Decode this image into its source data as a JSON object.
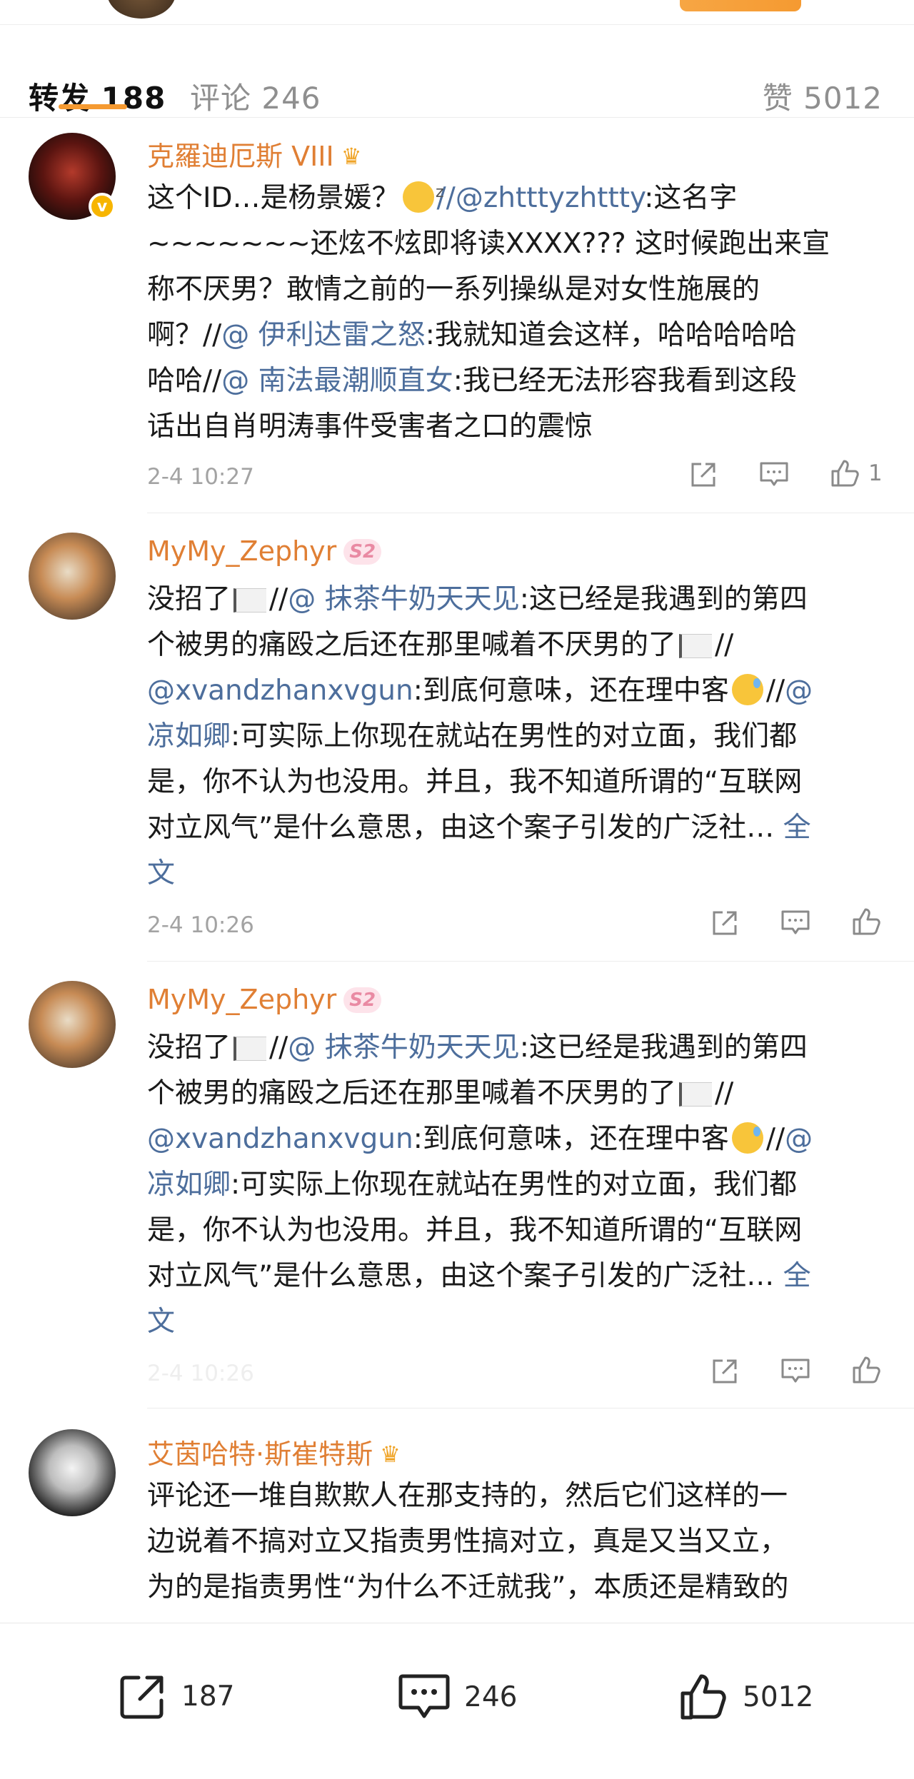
{
  "tabs": {
    "forward": "转发 188",
    "comment": "评论 246",
    "like": "赞 5012"
  },
  "posts": [
    {
      "name": "克羅迪厄斯 VIII",
      "lines": [
        [
          "这个ID…是杨景媛？",
          {
            "emoji": "smug"
          },
          {
            "link": "//@zhtttyzhttty"
          },
          ":这名字"
        ],
        [
          "~~~~~~~还炫不炫即将读XXXX???  这时候跑出来宣"
        ],
        [
          "称不厌男？敢情之前的一系列操纵是对女性施展的"
        ],
        [
          "啊？//",
          {
            "link": "@ 伊利达雷之怒"
          },
          ":我就知道会这样，哈哈哈哈哈"
        ],
        [
          "哈哈//",
          {
            "link": "@ 南法最潮顺直女"
          },
          ":我已经无法形容我看到这段"
        ],
        [
          "话出自肖明涛事件受害者之口的震惊"
        ]
      ],
      "time": "2-4 10:27",
      "likes": "1"
    },
    {
      "name": "MyMy_Zephyr",
      "level": "S2",
      "lines": [
        [
          "没招了",
          {
            "flag": true
          },
          "//",
          {
            "link": "@ 抹茶牛奶天天见"
          },
          ":这已经是我遇到的第四"
        ],
        [
          "个被男的痛殴之后还在那里喊着不厌男的了",
          {
            "flag": true
          },
          "//"
        ],
        [
          {
            "link": "@xvandzhanxvgun"
          },
          ":到底何意味，还在理中客",
          {
            "emoji": "sweat"
          },
          "//",
          {
            "link": "@"
          }
        ],
        [
          {
            "link": "凉如卿"
          },
          ":可实际上你现在就站在男性的对立面，我们都"
        ],
        [
          "是，你不认为也没用。并且，我不知道所谓的“互联网"
        ],
        [
          "对立风气”是什么意思，由这个案子引发的广泛社… ",
          {
            "link": "全"
          }
        ],
        [
          {
            "link": "文"
          }
        ]
      ],
      "time": "2-4 10:26",
      "likes": ""
    },
    {
      "name": "MyMy_Zephyr",
      "level": "S2",
      "lines": [
        [
          "没招了",
          {
            "flag": true
          },
          "//",
          {
            "link": "@ 抹茶牛奶天天见"
          },
          ":这已经是我遇到的第四"
        ],
        [
          "个被男的痛殴之后还在那里喊着不厌男的了",
          {
            "flag": true
          },
          "//"
        ],
        [
          {
            "link": "@xvandzhanxvgun"
          },
          ":到底何意味，还在理中客",
          {
            "emoji": "sweat"
          },
          "//",
          {
            "link": "@"
          }
        ],
        [
          {
            "link": "凉如卿"
          },
          ":可实际上你现在就站在男性的对立面，我们都"
        ],
        [
          "是，你不认为也没用。并且，我不知道所谓的“互联网"
        ],
        [
          "对立风气”是什么意思，由这个案子引发的广泛社… ",
          {
            "link": "全"
          }
        ],
        [
          {
            "link": "文"
          }
        ]
      ],
      "time": "2-4 10:26",
      "likes": ""
    },
    {
      "name": "艾茵哈特·斯崔特斯",
      "lines": [
        [
          "评论还一堆自欺欺人在那支持的，然后它们这样的一"
        ],
        [
          "边说着不搞对立又指责男性搞对立，真是又当又立，"
        ],
        [
          "为的是指责男性“为什么不迁就我”，本质还是精致的"
        ]
      ]
    }
  ],
  "bottom_bar": {
    "forward_count": "187",
    "comment_count": "246",
    "like_count": "5012"
  },
  "colors": {
    "accent": "#f59a31",
    "username": "#e07f34",
    "link": "#4d6e9c",
    "muted": "#a3a3a3"
  }
}
